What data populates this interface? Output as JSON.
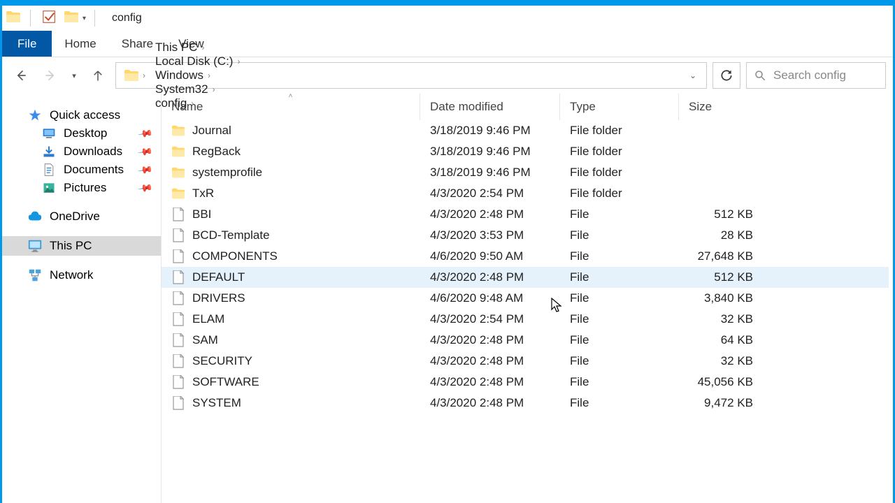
{
  "title": "config",
  "ribbon": {
    "file": "File",
    "home": "Home",
    "share": "Share",
    "view": "View"
  },
  "breadcrumbs": [
    "This PC",
    "Local Disk (C:)",
    "Windows",
    "System32",
    "config"
  ],
  "search_placeholder": "Search config",
  "sidebar": {
    "quick_access": "Quick access",
    "items": [
      {
        "label": "Desktop",
        "pinned": true
      },
      {
        "label": "Downloads",
        "pinned": true
      },
      {
        "label": "Documents",
        "pinned": true
      },
      {
        "label": "Pictures",
        "pinned": true
      }
    ],
    "onedrive": "OneDrive",
    "thispc": "This PC",
    "network": "Network"
  },
  "columns": {
    "name": "Name",
    "date": "Date modified",
    "type": "Type",
    "size": "Size"
  },
  "rows": [
    {
      "name": "Journal",
      "date": "3/18/2019 9:46 PM",
      "type": "File folder",
      "size": "",
      "kind": "folder"
    },
    {
      "name": "RegBack",
      "date": "3/18/2019 9:46 PM",
      "type": "File folder",
      "size": "",
      "kind": "folder"
    },
    {
      "name": "systemprofile",
      "date": "3/18/2019 9:46 PM",
      "type": "File folder",
      "size": "",
      "kind": "folder"
    },
    {
      "name": "TxR",
      "date": "4/3/2020 2:54 PM",
      "type": "File folder",
      "size": "",
      "kind": "folder"
    },
    {
      "name": "BBI",
      "date": "4/3/2020 2:48 PM",
      "type": "File",
      "size": "512 KB",
      "kind": "file"
    },
    {
      "name": "BCD-Template",
      "date": "4/3/2020 3:53 PM",
      "type": "File",
      "size": "28 KB",
      "kind": "file"
    },
    {
      "name": "COMPONENTS",
      "date": "4/6/2020 9:50 AM",
      "type": "File",
      "size": "27,648 KB",
      "kind": "file"
    },
    {
      "name": "DEFAULT",
      "date": "4/3/2020 2:48 PM",
      "type": "File",
      "size": "512 KB",
      "kind": "file",
      "hovered": true
    },
    {
      "name": "DRIVERS",
      "date": "4/6/2020 9:48 AM",
      "type": "File",
      "size": "3,840 KB",
      "kind": "file"
    },
    {
      "name": "ELAM",
      "date": "4/3/2020 2:54 PM",
      "type": "File",
      "size": "32 KB",
      "kind": "file"
    },
    {
      "name": "SAM",
      "date": "4/3/2020 2:48 PM",
      "type": "File",
      "size": "64 KB",
      "kind": "file"
    },
    {
      "name": "SECURITY",
      "date": "4/3/2020 2:48 PM",
      "type": "File",
      "size": "32 KB",
      "kind": "file"
    },
    {
      "name": "SOFTWARE",
      "date": "4/3/2020 2:48 PM",
      "type": "File",
      "size": "45,056 KB",
      "kind": "file"
    },
    {
      "name": "SYSTEM",
      "date": "4/3/2020 2:48 PM",
      "type": "File",
      "size": "9,472 KB",
      "kind": "file"
    }
  ]
}
